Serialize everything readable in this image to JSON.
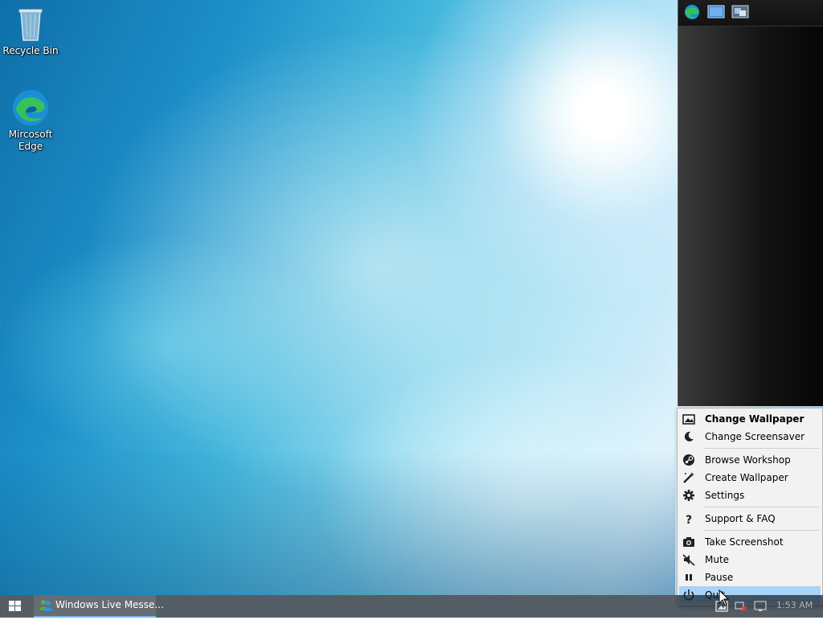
{
  "desktop": {
    "icons": [
      {
        "label": "Recycle Bin"
      },
      {
        "label": "Mircosoft Edge"
      }
    ]
  },
  "side_panel": {
    "icons": [
      "edge-icon",
      "desktop-icon",
      "windows-icon"
    ]
  },
  "context_menu": {
    "items": [
      {
        "label": "Change Wallpaper",
        "icon": "image-icon"
      },
      {
        "label": "Change Screensaver",
        "icon": "moon-icon"
      },
      {
        "label": "Browse Workshop",
        "icon": "steam-icon"
      },
      {
        "label": "Create Wallpaper",
        "icon": "wand-icon"
      },
      {
        "label": "Settings",
        "icon": "gear-icon"
      },
      {
        "label": "Support & FAQ",
        "icon": "question-icon"
      },
      {
        "label": "Take Screenshot",
        "icon": "camera-icon"
      },
      {
        "label": "Mute",
        "icon": "mute-icon"
      },
      {
        "label": "Pause",
        "icon": "pause-icon"
      },
      {
        "label": "Quit",
        "icon": "power-icon"
      }
    ],
    "hover_color": "#a9d3f7"
  },
  "taskbar": {
    "window_label": "Windows Live Messe...",
    "clock": "1:53 AM"
  },
  "colors": {
    "accent": "#7ab4e6",
    "menu_bg": "#f2f2f2"
  }
}
